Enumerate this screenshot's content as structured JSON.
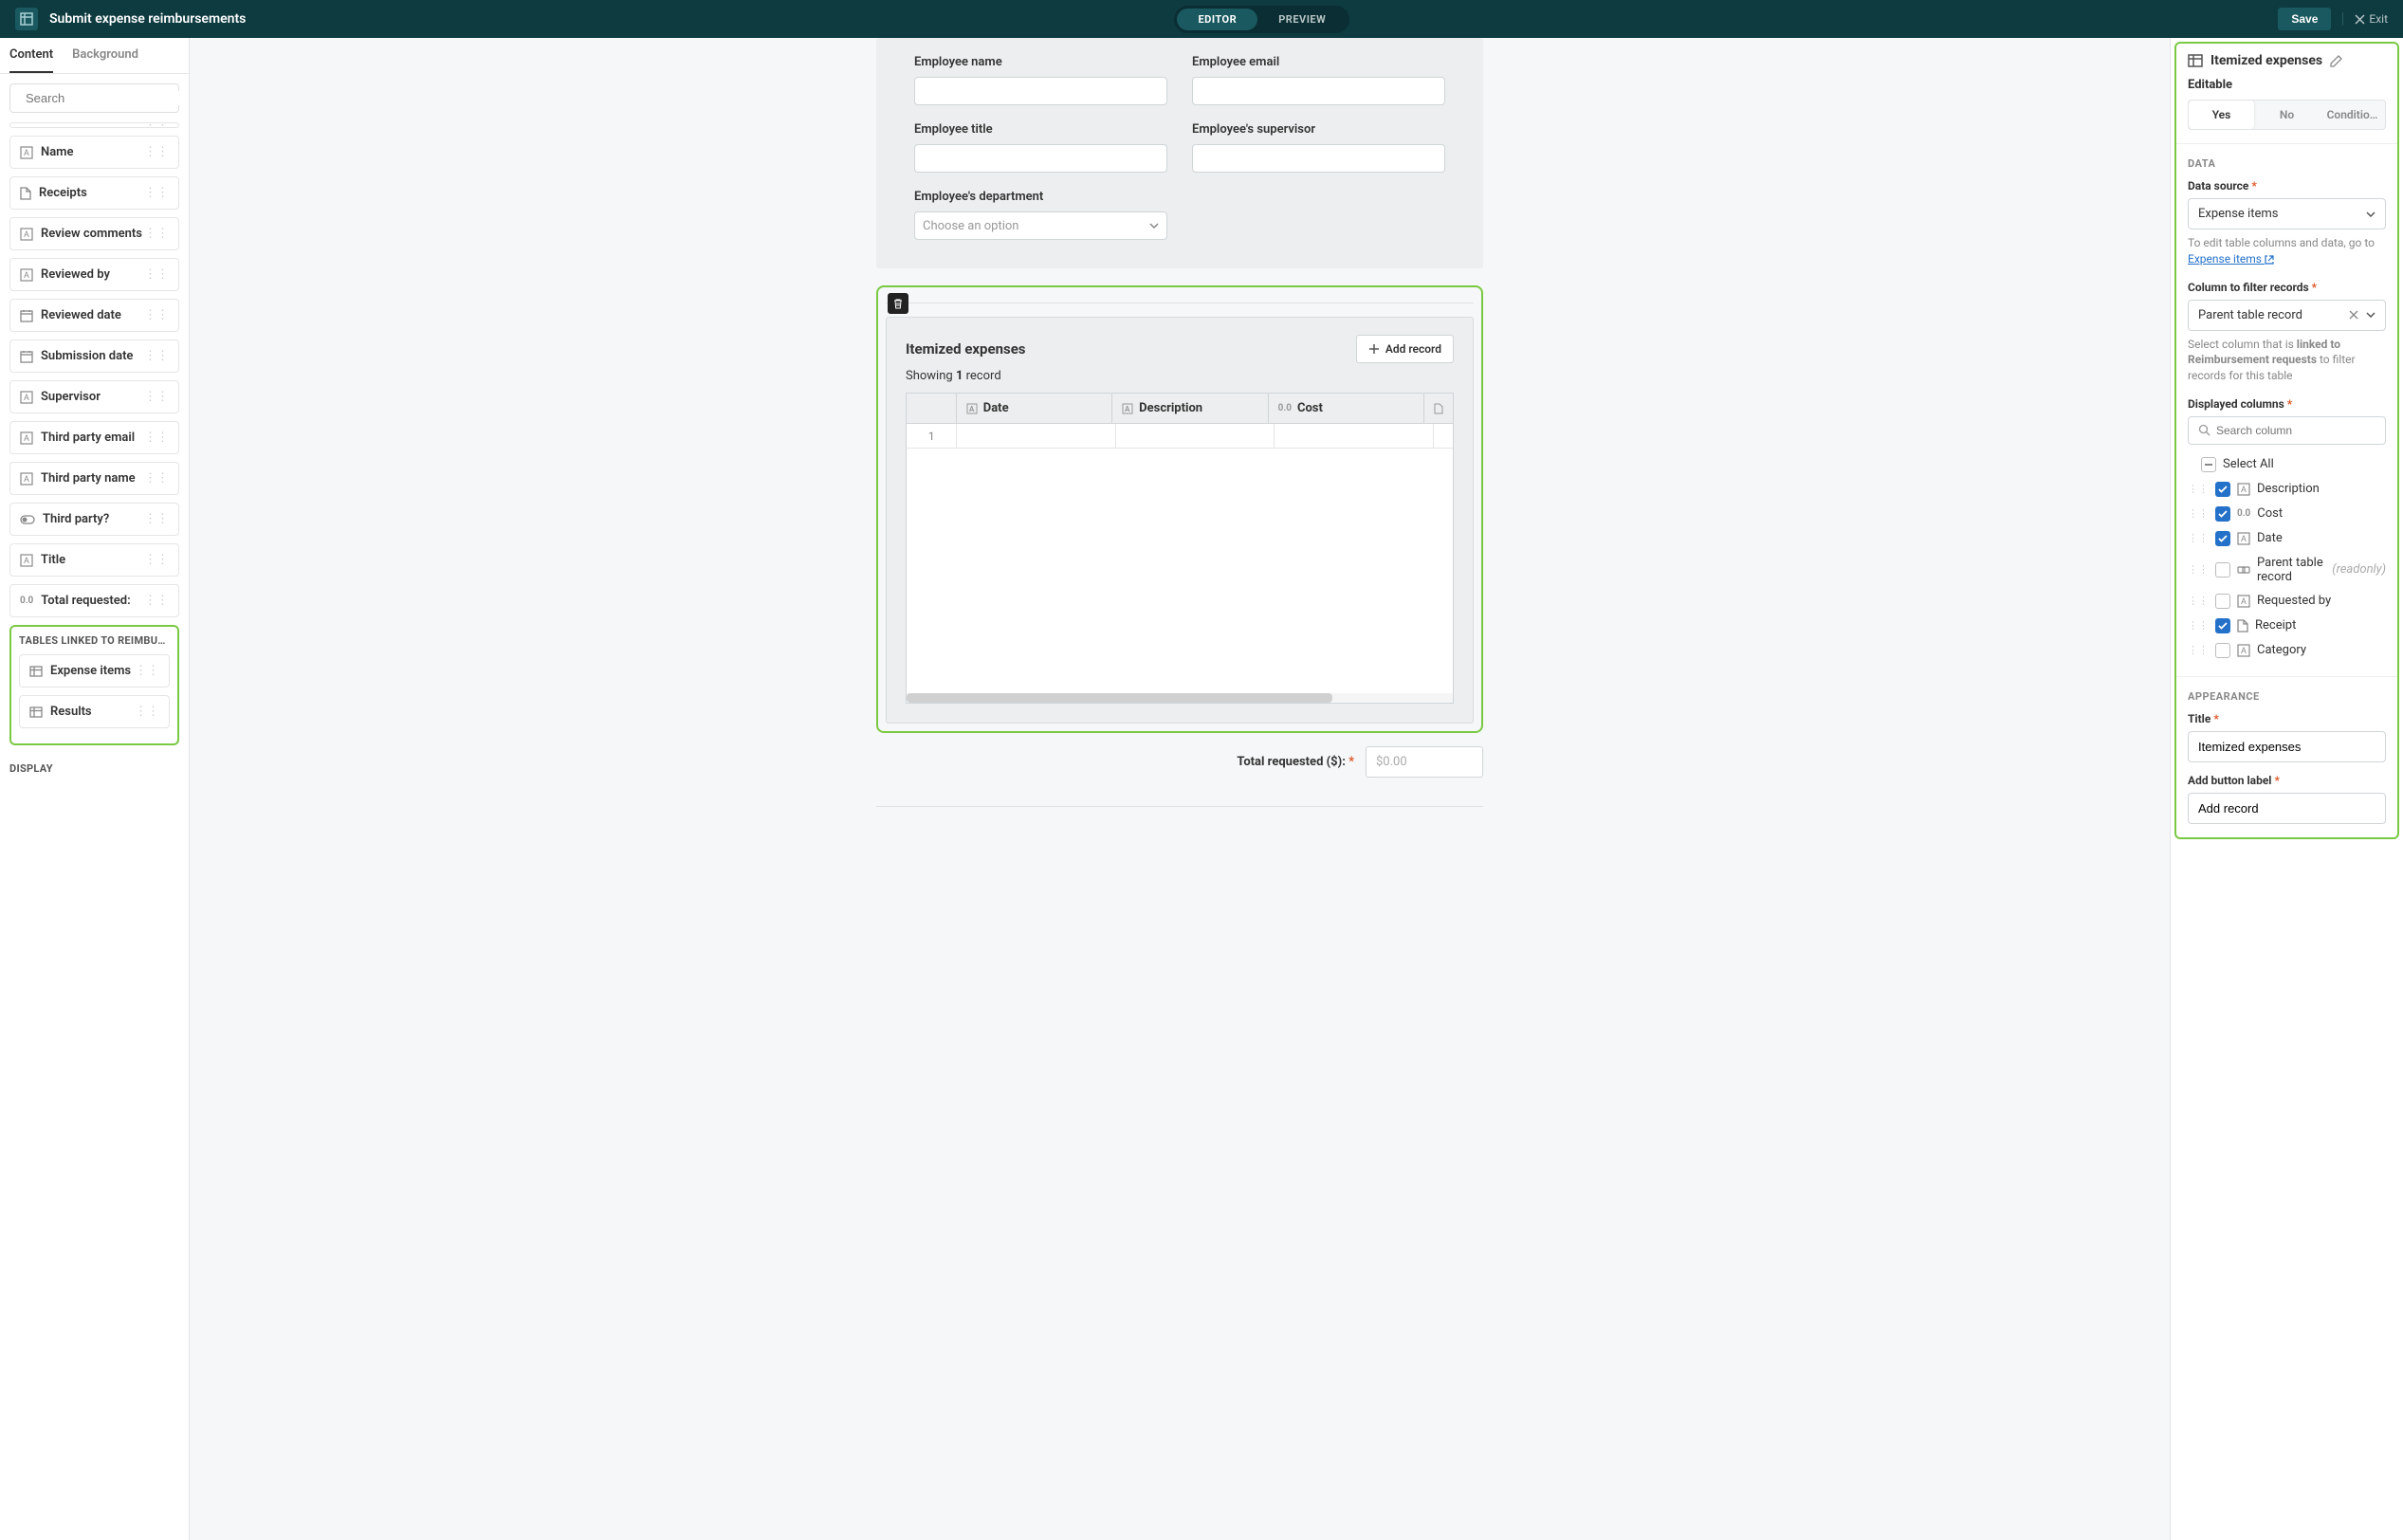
{
  "topbar": {
    "title": "Submit expense reimbursements",
    "editor": "EDITOR",
    "preview": "PREVIEW",
    "save": "Save",
    "exit": "Exit"
  },
  "sidebar": {
    "tabs": {
      "content": "Content",
      "background": "Background"
    },
    "search_placeholder": "Search",
    "fields": [
      {
        "label": "Name",
        "type": "text"
      },
      {
        "label": "Receipts",
        "type": "file"
      },
      {
        "label": "Review comments",
        "type": "text"
      },
      {
        "label": "Reviewed by",
        "type": "text"
      },
      {
        "label": "Reviewed date",
        "type": "date"
      },
      {
        "label": "Submission date",
        "type": "date"
      },
      {
        "label": "Supervisor",
        "type": "text"
      },
      {
        "label": "Third party email",
        "type": "text"
      },
      {
        "label": "Third party name",
        "type": "text"
      },
      {
        "label": "Third party?",
        "type": "toggle"
      },
      {
        "label": "Title",
        "type": "text"
      },
      {
        "label": "Total requested:",
        "type": "number"
      }
    ],
    "linked_header": "TABLES LINKED TO REIMBU…",
    "linked_tables": [
      {
        "label": "Expense items"
      },
      {
        "label": "Results"
      }
    ],
    "display_header": "DISPLAY"
  },
  "form": {
    "employee_name": "Employee name",
    "employee_email": "Employee email",
    "employee_title": "Employee title",
    "supervisor": "Employee's supervisor",
    "department": "Employee's department",
    "choose_option": "Choose an option"
  },
  "table": {
    "title": "Itemized expenses",
    "showing_pre": "Showing ",
    "showing_count": "1",
    "showing_post": " record",
    "add_record": "Add record",
    "columns": {
      "date": "Date",
      "description": "Description",
      "cost": "Cost"
    },
    "row1_num": "1"
  },
  "total": {
    "label": "Total requested ($): ",
    "placeholder": "$0.00"
  },
  "inspector": {
    "title": "Itemized expenses",
    "editable_label": "Editable",
    "yes": "Yes",
    "no": "No",
    "conditional": "Conditio…",
    "data_heading": "DATA",
    "data_source_label": "Data source ",
    "data_source_value": "Expense items",
    "data_source_help_pre": "To edit table columns and data, go to ",
    "data_source_link": "Expense items",
    "filter_label": "Column to filter records ",
    "filter_value": "Parent table record",
    "filter_help_pre": "Select column that is ",
    "filter_help_bold": "linked to Reimbursement requests",
    "filter_help_post": " to filter records for this table",
    "displayed_label": "Displayed columns ",
    "search_column_placeholder": "Search column",
    "select_all": "Select All",
    "columns": [
      {
        "label": "Description",
        "checked": true,
        "type": "text"
      },
      {
        "label": "Cost",
        "checked": true,
        "type": "number"
      },
      {
        "label": "Date",
        "checked": true,
        "type": "text"
      },
      {
        "label": "Parent table record",
        "checked": false,
        "type": "link",
        "readonly": "(readonly)"
      },
      {
        "label": "Requested by",
        "checked": false,
        "type": "text"
      },
      {
        "label": "Receipt",
        "checked": true,
        "type": "file"
      },
      {
        "label": "Category",
        "checked": false,
        "type": "text"
      }
    ],
    "appearance_heading": "APPEARANCE",
    "title_label": "Title ",
    "title_value": "Itemized expenses",
    "add_btn_label": "Add button label ",
    "add_btn_value": "Add record"
  }
}
